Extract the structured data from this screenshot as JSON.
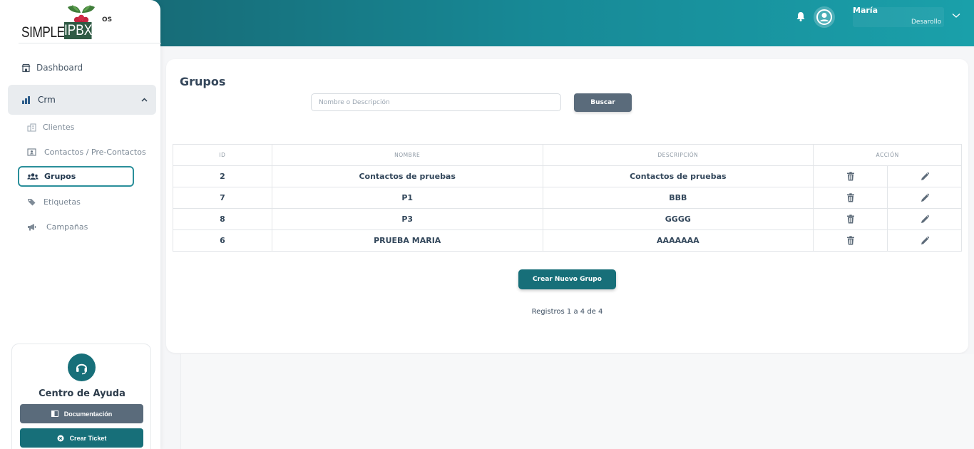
{
  "logo": {
    "text": "SIMPLE",
    "badge": "IPBX",
    "suffix": "OS"
  },
  "header": {
    "user_name": "María",
    "user_role": "Desarollo"
  },
  "sidebar": {
    "dashboard": "Dashboard",
    "crm": "Crm",
    "sub_items": [
      "Clientes",
      "Contactos / Pre-Contactos",
      "Grupos",
      "Etiquetas",
      "Campañas"
    ]
  },
  "help": {
    "title": "Centro de Ayuda",
    "doc_button": "Documentación",
    "ticket_button": "Crear Ticket"
  },
  "main": {
    "title": "Grupos",
    "search_placeholder": "Nombre o Descripción",
    "search_button": "Buscar",
    "table": {
      "headers": [
        "ID",
        "NOMBRE",
        "DESCRIPCIÓN",
        "ACCIÓN"
      ],
      "rows": [
        {
          "id": "2",
          "nombre": "Contactos de pruebas",
          "descripcion": "Contactos de pruebas"
        },
        {
          "id": "7",
          "nombre": "P1",
          "descripcion": "BBB"
        },
        {
          "id": "8",
          "nombre": "P3",
          "descripcion": "GGGG"
        },
        {
          "id": "6",
          "nombre": "PRUEBA MARIA",
          "descripcion": "AAAAAAA"
        }
      ]
    },
    "create_button": "Crear Nuevo Grupo",
    "records": "Registros 1 a 4 de 4"
  },
  "colors": {
    "primary": "#176f79",
    "secondary": "#5a6b7b",
    "header_start": "#17606b",
    "header_end": "#1aa0aa"
  },
  "icons": [
    "bell-icon",
    "user-circle-icon",
    "chevron-down-icon",
    "store-icon",
    "chart-bar-icon",
    "chevron-up-icon",
    "building-icon",
    "id-card-icon",
    "users-icon",
    "tags-icon",
    "bullhorn-icon",
    "headset-icon",
    "book-icon",
    "x-circle-icon",
    "trash-icon",
    "pencil-icon"
  ]
}
